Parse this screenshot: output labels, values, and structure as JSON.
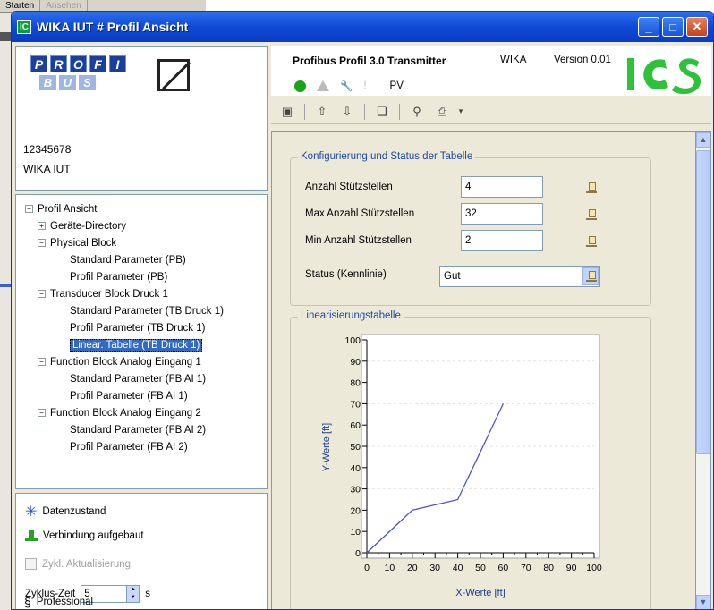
{
  "background": {
    "tabs": [
      "Starten",
      "Ansehen"
    ]
  },
  "window": {
    "app_icon_text": "IC",
    "title": "WIKA IUT # Profil Ansicht"
  },
  "device": {
    "profibus_top": [
      "P",
      "R",
      "O",
      "F",
      "I"
    ],
    "profibus_bottom": [
      "B",
      "U",
      "S"
    ],
    "id": "12345678",
    "name": "WIKA IUT"
  },
  "tree": {
    "items": [
      {
        "label": "Profil Ansicht",
        "expander": "⊟"
      },
      {
        "label": "Geräte-Directory",
        "expander": "⊞"
      },
      {
        "label": "Physical Block",
        "expander": "⊟"
      },
      {
        "label": "Standard Parameter (PB)",
        "expander": ""
      },
      {
        "label": "Profil Parameter (PB)",
        "expander": ""
      },
      {
        "label": "Transducer Block Druck 1",
        "expander": "⊟"
      },
      {
        "label": "Standard Parameter (TB Druck 1)",
        "expander": ""
      },
      {
        "label": "Profil Parameter (TB Druck 1)",
        "expander": ""
      },
      {
        "label": "Linear. Tabelle (TB Druck 1)",
        "expander": ""
      },
      {
        "label": "Function Block Analog Eingang 1",
        "expander": "⊟"
      },
      {
        "label": "Standard Parameter (FB AI 1)",
        "expander": ""
      },
      {
        "label": "Profil Parameter (FB AI 1)",
        "expander": ""
      },
      {
        "label": "Function Block Analog Eingang 2",
        "expander": "⊟"
      },
      {
        "label": "Standard Parameter (FB AI 2)",
        "expander": ""
      },
      {
        "label": "Profil Parameter (FB AI 2)",
        "expander": ""
      }
    ]
  },
  "status": {
    "data_state": "Datenzustand",
    "connection": "Verbindung aufgebaut",
    "cyclic_update": "Zykl. Aktualisierung",
    "cycle_time_label": "Zyklus-Zeit",
    "cycle_time_value": "5",
    "cycle_time_unit": "s",
    "edition": "Professional",
    "edition_icon": "§"
  },
  "header": {
    "title": "Profibus Profil 3.0 Transmitter",
    "vendor": "WIKA",
    "version": "Version 0.01",
    "pv_label": "PV",
    "excl": "!"
  },
  "config": {
    "caption": "Konfigurierung und Status der Tabelle",
    "rows": [
      {
        "label": "Anzahl Stützstellen",
        "value": "4"
      },
      {
        "label": "Max Anzahl Stützstellen",
        "value": "32"
      },
      {
        "label": "Min Anzahl Stützstellen",
        "value": "2"
      }
    ],
    "status_label": "Status (Kennlinie)",
    "status_value": "Gut"
  },
  "linear": {
    "caption": "Linearisierungstabelle"
  },
  "chart_data": {
    "type": "line",
    "xlabel": "X-Werte [ft]",
    "ylabel": "Y-Werte [ft]",
    "xlim": [
      0,
      100
    ],
    "ylim": [
      0,
      100
    ],
    "x_ticks": [
      0,
      10,
      20,
      30,
      40,
      50,
      60,
      70,
      80,
      90,
      100
    ],
    "y_ticks": [
      0,
      10,
      20,
      30,
      40,
      50,
      60,
      70,
      80,
      90,
      100
    ],
    "series": [
      {
        "x": [
          0,
          20,
          40,
          60
        ],
        "y": [
          0,
          20,
          25,
          70
        ]
      }
    ],
    "line_color": "#5050d0",
    "grid": false
  }
}
